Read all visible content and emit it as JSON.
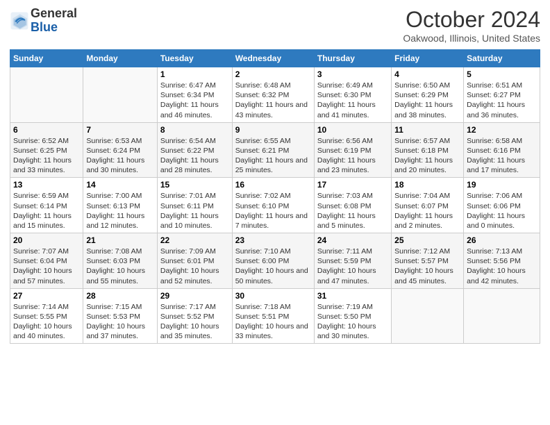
{
  "header": {
    "logo_line1": "General",
    "logo_line2": "Blue",
    "month_title": "October 2024",
    "location": "Oakwood, Illinois, United States"
  },
  "days_of_week": [
    "Sunday",
    "Monday",
    "Tuesday",
    "Wednesday",
    "Thursday",
    "Friday",
    "Saturday"
  ],
  "weeks": [
    [
      {
        "num": "",
        "sunrise": "",
        "sunset": "",
        "daylight": ""
      },
      {
        "num": "",
        "sunrise": "",
        "sunset": "",
        "daylight": ""
      },
      {
        "num": "1",
        "sunrise": "Sunrise: 6:47 AM",
        "sunset": "Sunset: 6:34 PM",
        "daylight": "Daylight: 11 hours and 46 minutes."
      },
      {
        "num": "2",
        "sunrise": "Sunrise: 6:48 AM",
        "sunset": "Sunset: 6:32 PM",
        "daylight": "Daylight: 11 hours and 43 minutes."
      },
      {
        "num": "3",
        "sunrise": "Sunrise: 6:49 AM",
        "sunset": "Sunset: 6:30 PM",
        "daylight": "Daylight: 11 hours and 41 minutes."
      },
      {
        "num": "4",
        "sunrise": "Sunrise: 6:50 AM",
        "sunset": "Sunset: 6:29 PM",
        "daylight": "Daylight: 11 hours and 38 minutes."
      },
      {
        "num": "5",
        "sunrise": "Sunrise: 6:51 AM",
        "sunset": "Sunset: 6:27 PM",
        "daylight": "Daylight: 11 hours and 36 minutes."
      }
    ],
    [
      {
        "num": "6",
        "sunrise": "Sunrise: 6:52 AM",
        "sunset": "Sunset: 6:25 PM",
        "daylight": "Daylight: 11 hours and 33 minutes."
      },
      {
        "num": "7",
        "sunrise": "Sunrise: 6:53 AM",
        "sunset": "Sunset: 6:24 PM",
        "daylight": "Daylight: 11 hours and 30 minutes."
      },
      {
        "num": "8",
        "sunrise": "Sunrise: 6:54 AM",
        "sunset": "Sunset: 6:22 PM",
        "daylight": "Daylight: 11 hours and 28 minutes."
      },
      {
        "num": "9",
        "sunrise": "Sunrise: 6:55 AM",
        "sunset": "Sunset: 6:21 PM",
        "daylight": "Daylight: 11 hours and 25 minutes."
      },
      {
        "num": "10",
        "sunrise": "Sunrise: 6:56 AM",
        "sunset": "Sunset: 6:19 PM",
        "daylight": "Daylight: 11 hours and 23 minutes."
      },
      {
        "num": "11",
        "sunrise": "Sunrise: 6:57 AM",
        "sunset": "Sunset: 6:18 PM",
        "daylight": "Daylight: 11 hours and 20 minutes."
      },
      {
        "num": "12",
        "sunrise": "Sunrise: 6:58 AM",
        "sunset": "Sunset: 6:16 PM",
        "daylight": "Daylight: 11 hours and 17 minutes."
      }
    ],
    [
      {
        "num": "13",
        "sunrise": "Sunrise: 6:59 AM",
        "sunset": "Sunset: 6:14 PM",
        "daylight": "Daylight: 11 hours and 15 minutes."
      },
      {
        "num": "14",
        "sunrise": "Sunrise: 7:00 AM",
        "sunset": "Sunset: 6:13 PM",
        "daylight": "Daylight: 11 hours and 12 minutes."
      },
      {
        "num": "15",
        "sunrise": "Sunrise: 7:01 AM",
        "sunset": "Sunset: 6:11 PM",
        "daylight": "Daylight: 11 hours and 10 minutes."
      },
      {
        "num": "16",
        "sunrise": "Sunrise: 7:02 AM",
        "sunset": "Sunset: 6:10 PM",
        "daylight": "Daylight: 11 hours and 7 minutes."
      },
      {
        "num": "17",
        "sunrise": "Sunrise: 7:03 AM",
        "sunset": "Sunset: 6:08 PM",
        "daylight": "Daylight: 11 hours and 5 minutes."
      },
      {
        "num": "18",
        "sunrise": "Sunrise: 7:04 AM",
        "sunset": "Sunset: 6:07 PM",
        "daylight": "Daylight: 11 hours and 2 minutes."
      },
      {
        "num": "19",
        "sunrise": "Sunrise: 7:06 AM",
        "sunset": "Sunset: 6:06 PM",
        "daylight": "Daylight: 11 hours and 0 minutes."
      }
    ],
    [
      {
        "num": "20",
        "sunrise": "Sunrise: 7:07 AM",
        "sunset": "Sunset: 6:04 PM",
        "daylight": "Daylight: 10 hours and 57 minutes."
      },
      {
        "num": "21",
        "sunrise": "Sunrise: 7:08 AM",
        "sunset": "Sunset: 6:03 PM",
        "daylight": "Daylight: 10 hours and 55 minutes."
      },
      {
        "num": "22",
        "sunrise": "Sunrise: 7:09 AM",
        "sunset": "Sunset: 6:01 PM",
        "daylight": "Daylight: 10 hours and 52 minutes."
      },
      {
        "num": "23",
        "sunrise": "Sunrise: 7:10 AM",
        "sunset": "Sunset: 6:00 PM",
        "daylight": "Daylight: 10 hours and 50 minutes."
      },
      {
        "num": "24",
        "sunrise": "Sunrise: 7:11 AM",
        "sunset": "Sunset: 5:59 PM",
        "daylight": "Daylight: 10 hours and 47 minutes."
      },
      {
        "num": "25",
        "sunrise": "Sunrise: 7:12 AM",
        "sunset": "Sunset: 5:57 PM",
        "daylight": "Daylight: 10 hours and 45 minutes."
      },
      {
        "num": "26",
        "sunrise": "Sunrise: 7:13 AM",
        "sunset": "Sunset: 5:56 PM",
        "daylight": "Daylight: 10 hours and 42 minutes."
      }
    ],
    [
      {
        "num": "27",
        "sunrise": "Sunrise: 7:14 AM",
        "sunset": "Sunset: 5:55 PM",
        "daylight": "Daylight: 10 hours and 40 minutes."
      },
      {
        "num": "28",
        "sunrise": "Sunrise: 7:15 AM",
        "sunset": "Sunset: 5:53 PM",
        "daylight": "Daylight: 10 hours and 37 minutes."
      },
      {
        "num": "29",
        "sunrise": "Sunrise: 7:17 AM",
        "sunset": "Sunset: 5:52 PM",
        "daylight": "Daylight: 10 hours and 35 minutes."
      },
      {
        "num": "30",
        "sunrise": "Sunrise: 7:18 AM",
        "sunset": "Sunset: 5:51 PM",
        "daylight": "Daylight: 10 hours and 33 minutes."
      },
      {
        "num": "31",
        "sunrise": "Sunrise: 7:19 AM",
        "sunset": "Sunset: 5:50 PM",
        "daylight": "Daylight: 10 hours and 30 minutes."
      },
      {
        "num": "",
        "sunrise": "",
        "sunset": "",
        "daylight": ""
      },
      {
        "num": "",
        "sunrise": "",
        "sunset": "",
        "daylight": ""
      }
    ]
  ]
}
